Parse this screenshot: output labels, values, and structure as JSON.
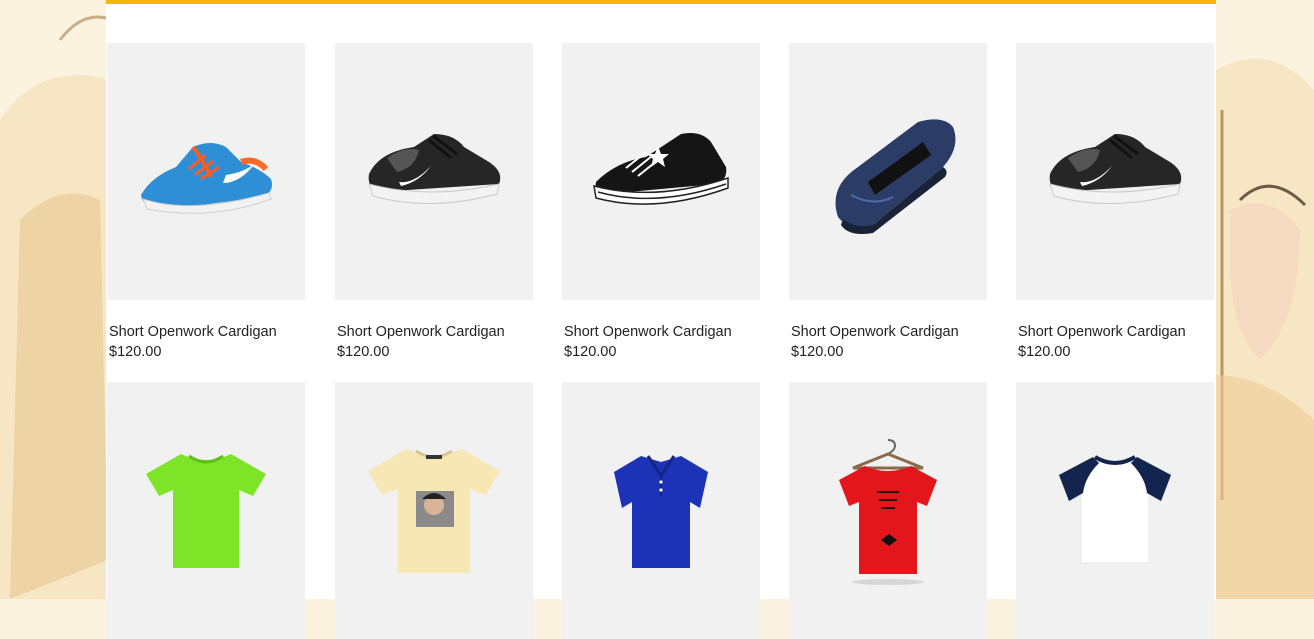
{
  "theme": {
    "accent": "#f0b90b",
    "thumb_bg": "#f1f1f1",
    "page_bg": "#fbf3df"
  },
  "products": [
    {
      "name": "Short Openwork Cardigan",
      "price": "$120.00",
      "icon": "blue-running-shoe-icon"
    },
    {
      "name": "Short Openwork Cardigan",
      "price": "$120.00",
      "icon": "black-sneaker-icon"
    },
    {
      "name": "Short Openwork Cardigan",
      "price": "$120.00",
      "icon": "canvas-sneaker-icon"
    },
    {
      "name": "Short Openwork Cardigan",
      "price": "$120.00",
      "icon": "navy-loafer-icon"
    },
    {
      "name": "Short Openwork Cardigan",
      "price": "$120.00",
      "icon": "black-sneaker-icon"
    },
    {
      "icon": "green-tshirt-icon"
    },
    {
      "icon": "cream-graphic-tshirt-icon"
    },
    {
      "icon": "blue-polo-shirt-icon"
    },
    {
      "icon": "red-tshirt-on-hanger-icon"
    },
    {
      "icon": "raglan-tshirt-icon"
    }
  ]
}
